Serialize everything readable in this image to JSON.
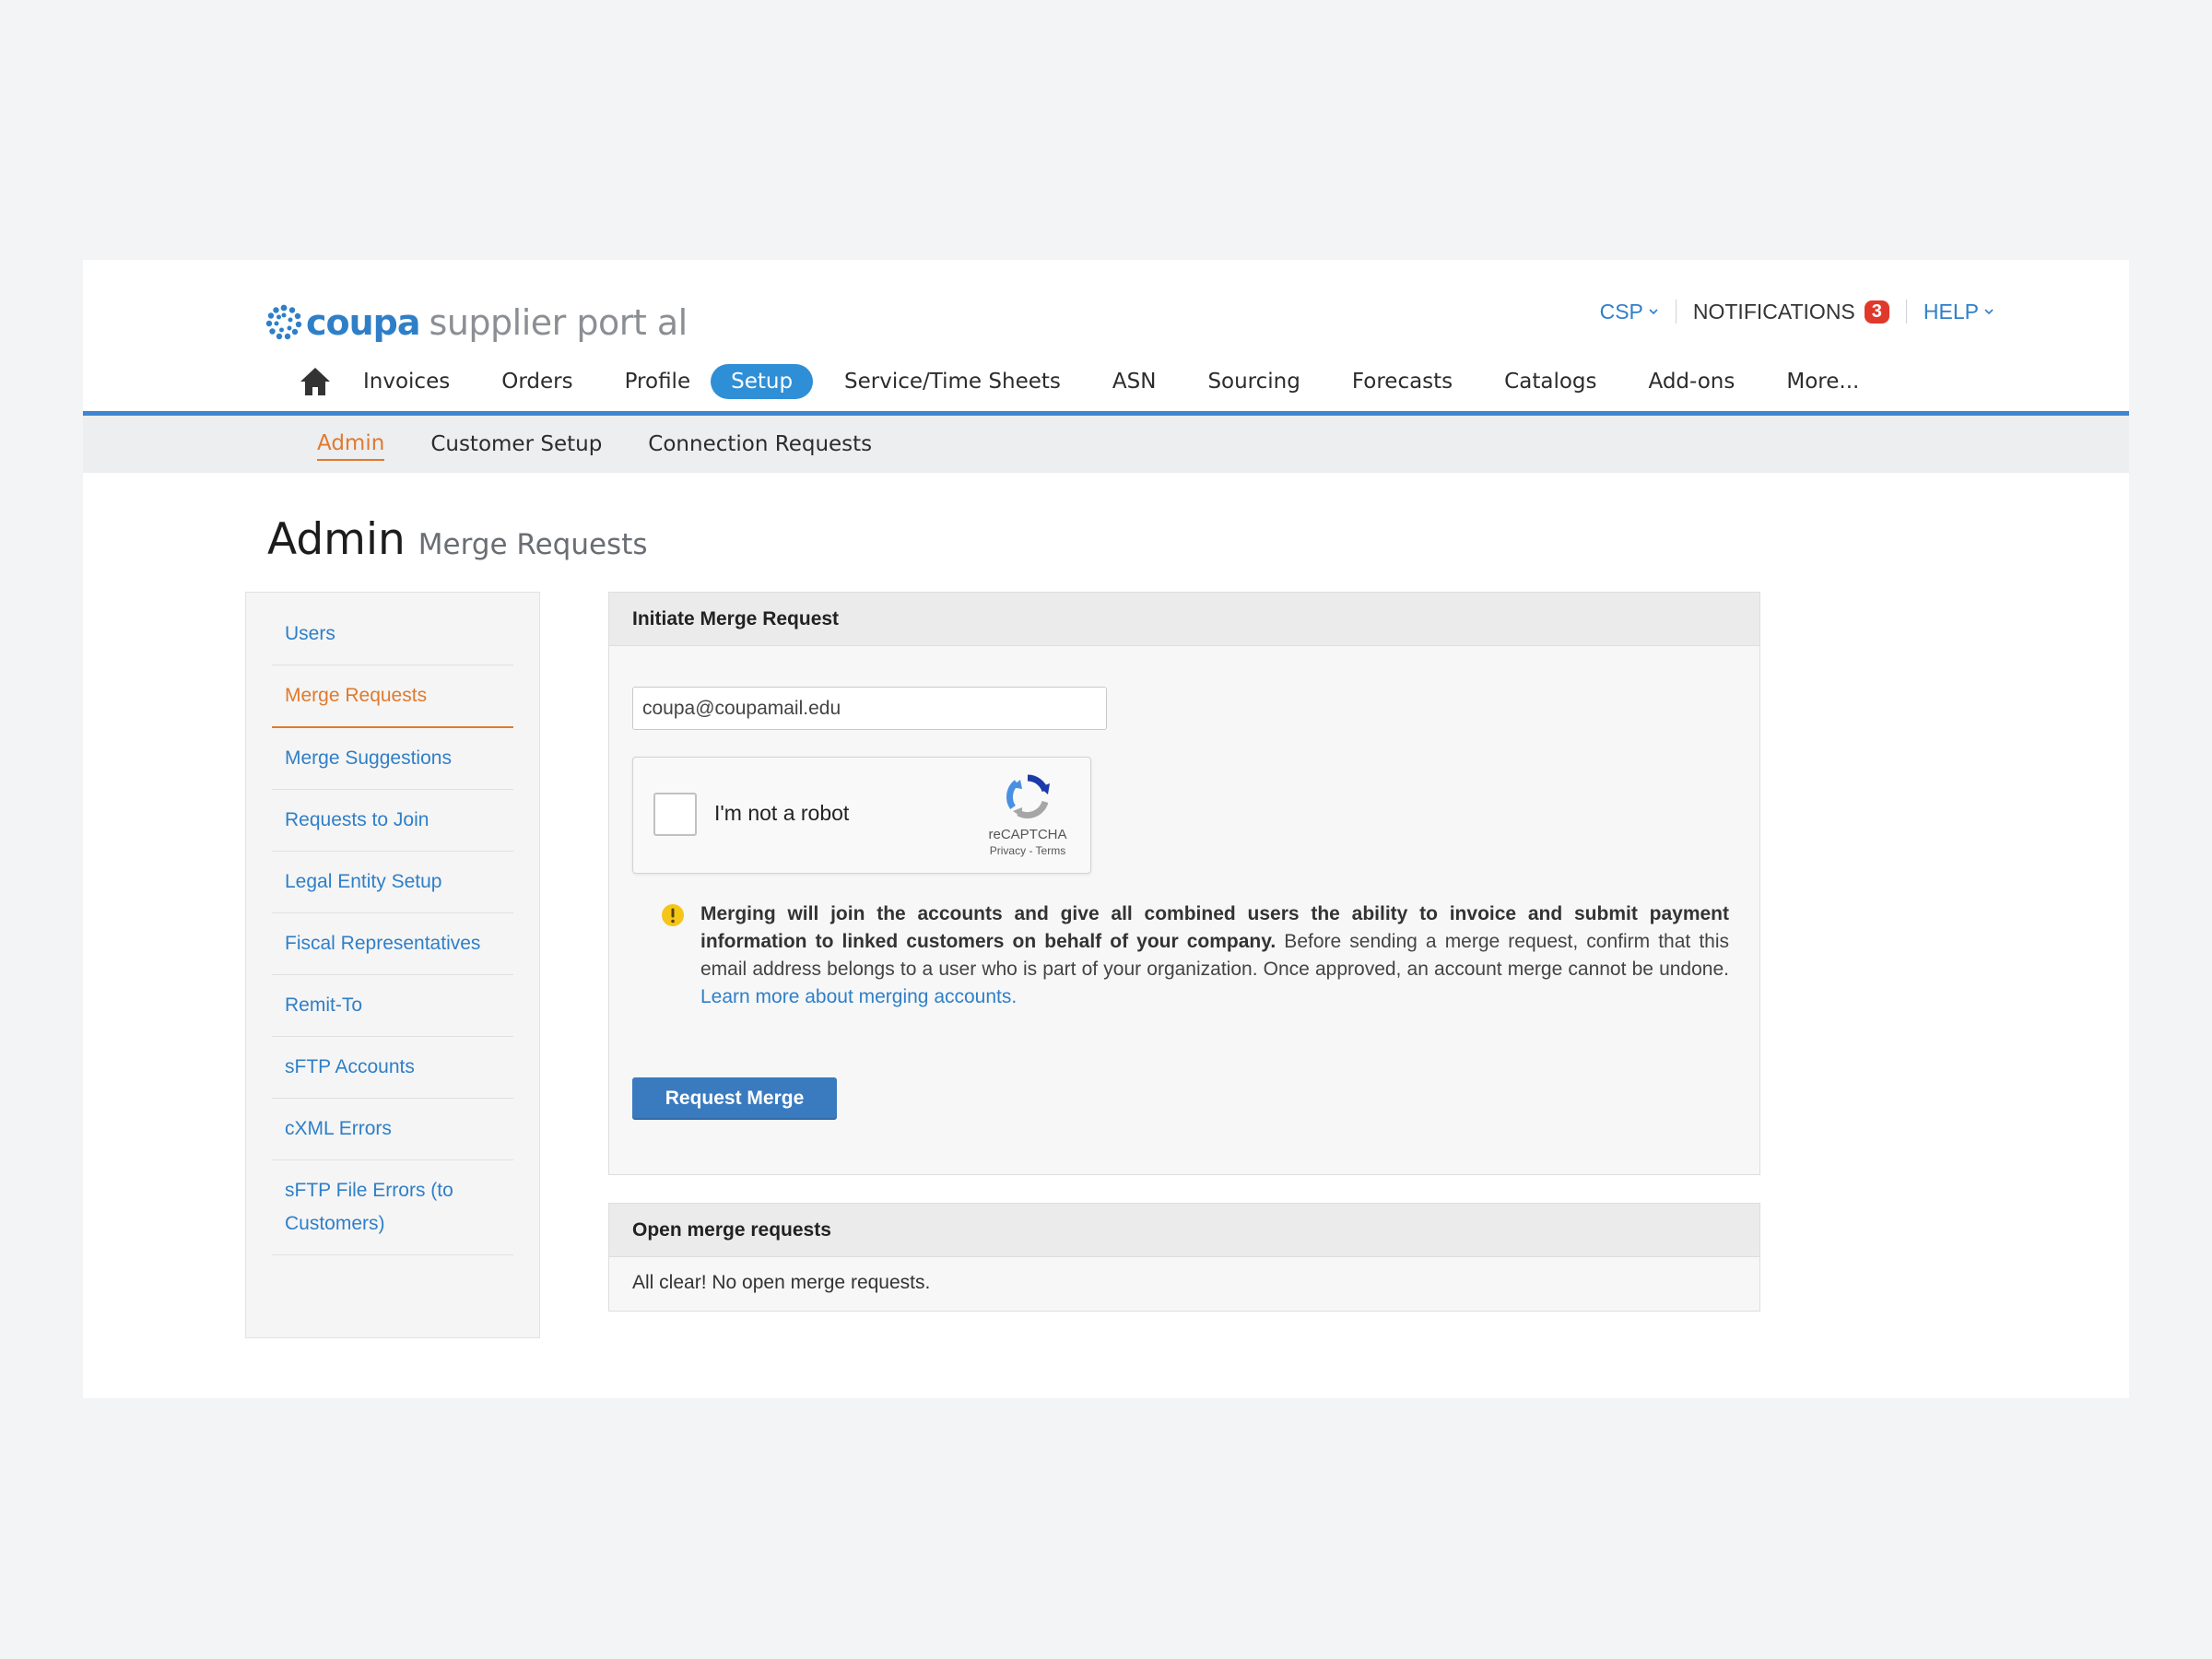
{
  "header": {
    "logo": {
      "brand": "coupa",
      "rest": "supplier port al"
    },
    "utility": {
      "csp_label": "CSP",
      "notifications_label": "NOTIFICATIONS",
      "notifications_count": "3",
      "help_label": "HELP"
    }
  },
  "nav": {
    "items": [
      {
        "label": "Invoices"
      },
      {
        "label": "Orders"
      },
      {
        "label": "Profile"
      },
      {
        "label": "Setup",
        "active": true
      },
      {
        "label": "Service/Time Sheets"
      },
      {
        "label": "ASN"
      },
      {
        "label": "Sourcing"
      },
      {
        "label": "Forecasts"
      },
      {
        "label": "Catalogs"
      },
      {
        "label": "Add-ons"
      },
      {
        "label": "More..."
      }
    ]
  },
  "subnav": {
    "items": [
      {
        "label": "Admin",
        "active": true
      },
      {
        "label": "Customer Setup"
      },
      {
        "label": "Connection Requests"
      }
    ]
  },
  "page": {
    "title": "Admin",
    "subtitle": "Merge Requests"
  },
  "sidebar": {
    "items": [
      {
        "label": "Users"
      },
      {
        "label": "Merge Requests",
        "active": true
      },
      {
        "label": "Merge Suggestions"
      },
      {
        "label": "Requests to Join"
      },
      {
        "label": "Legal Entity Setup"
      },
      {
        "label": "Fiscal Representatives"
      },
      {
        "label": "Remit-To"
      },
      {
        "label": "sFTP Accounts"
      },
      {
        "label": "cXML Errors"
      },
      {
        "label": "sFTP File Errors (to Customers)"
      }
    ]
  },
  "merge_panel": {
    "title": "Initiate Merge Request",
    "email_value": "coupa@coupamail.edu",
    "captcha": {
      "label": "I'm not a robot",
      "brand": "reCAPTCHA",
      "links": "Privacy - Terms"
    },
    "warning_bold": "Merging will join the accounts and give all combined users the ability to invoice and submit payment information to linked customers on behalf of your company.",
    "warning_text": " Before sending a merge request, confirm that this email address belongs to a user who is part of your organization. Once approved, an account merge cannot be undone. ",
    "warning_link": "Learn more about merging accounts.",
    "button_label": "Request Merge"
  },
  "open_panel": {
    "title": "Open merge requests",
    "empty_text": "All clear! No open merge requests."
  },
  "colors": {
    "accent": "#2f7fc8",
    "active_tab": "#2f8fd6",
    "orange": "#e07a2e",
    "badge": "#e0392b"
  },
  "icons": [
    "coupa-logo-icon",
    "chevron-down-icon",
    "home-icon",
    "recaptcha-icon",
    "warning-icon"
  ]
}
